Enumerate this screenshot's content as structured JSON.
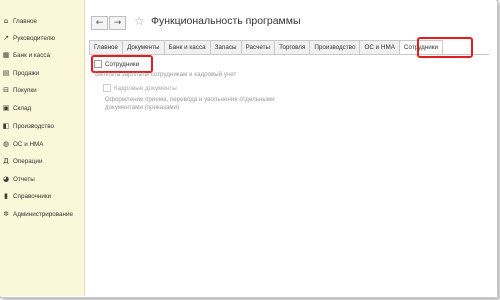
{
  "sidebar": {
    "items": [
      {
        "label": "Главное",
        "icon": "home-icon",
        "glyph": "⌂"
      },
      {
        "label": "Руководителю",
        "icon": "chart-icon",
        "glyph": "↗"
      },
      {
        "label": "Банк и касса",
        "icon": "bank-icon",
        "glyph": "▦"
      },
      {
        "label": "Продажи",
        "icon": "sales-icon",
        "glyph": "▤"
      },
      {
        "label": "Покупки",
        "icon": "cart-icon",
        "glyph": "⊟"
      },
      {
        "label": "Склад",
        "icon": "warehouse-icon",
        "glyph": "▣"
      },
      {
        "label": "Производство",
        "icon": "factory-icon",
        "glyph": "◧"
      },
      {
        "label": "ОС и НМА",
        "icon": "assets-icon",
        "glyph": "◍"
      },
      {
        "label": "Операции",
        "icon": "operations-icon",
        "glyph": "Д"
      },
      {
        "label": "Отчеты",
        "icon": "reports-icon",
        "glyph": "◕"
      },
      {
        "label": "Справочники",
        "icon": "books-icon",
        "glyph": "▮"
      },
      {
        "label": "Администрирование",
        "icon": "gear-icon",
        "glyph": "✲"
      }
    ]
  },
  "header": {
    "back_glyph": "←",
    "forward_glyph": "→",
    "star_glyph": "☆",
    "title": "Функциональность программы"
  },
  "tabs": [
    {
      "label": "Главное",
      "active": false
    },
    {
      "label": "Документы",
      "active": false
    },
    {
      "label": "Банк и касса",
      "active": false
    },
    {
      "label": "Запасы",
      "active": false
    },
    {
      "label": "Расчеты",
      "active": false
    },
    {
      "label": "Торговля",
      "active": false
    },
    {
      "label": "Производство",
      "active": false
    },
    {
      "label": "ОС и НМА",
      "active": false
    },
    {
      "label": "Сотрудники",
      "active": true
    }
  ],
  "content": {
    "main_checkbox_label": "Сотрудники",
    "main_checkbox_checked": false,
    "main_description": "Выплата зарплаты сотрудникам и кадровый учет",
    "sub_checkbox_label": "Кадровые документы",
    "sub_checkbox_checked": false,
    "sub_description": "Оформление приема, перевода и увольнения отдельными документами (приказами)"
  },
  "colors": {
    "sidebar_bg": "#fbf7d9",
    "highlight": "#e21e1e"
  }
}
